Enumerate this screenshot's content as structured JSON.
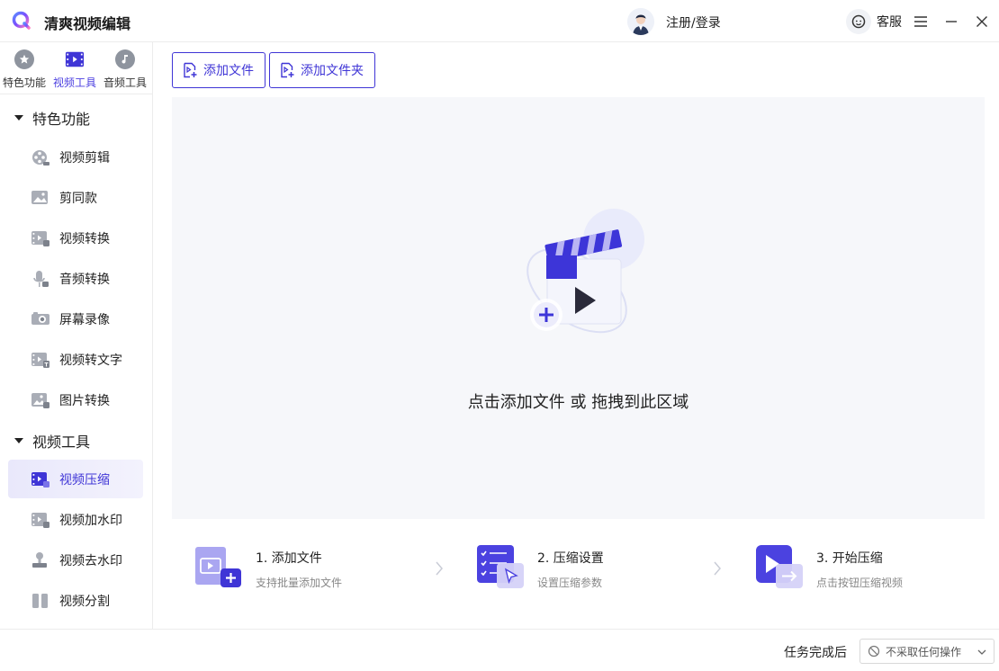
{
  "app": {
    "title": "清爽视频编辑"
  },
  "header": {
    "login_label": "注册/登录",
    "support_label": "客服"
  },
  "tool_tabs": [
    {
      "label": "特色功能",
      "icon": "star-icon"
    },
    {
      "label": "视频工具",
      "icon": "film-icon",
      "active": true
    },
    {
      "label": "音频工具",
      "icon": "music-note-icon"
    }
  ],
  "sidebar": {
    "sections": [
      {
        "title": "特色功能",
        "items": [
          {
            "label": "视频剪辑",
            "icon": "film-reel-icon"
          },
          {
            "label": "剪同款",
            "icon": "image-icon"
          },
          {
            "label": "视频转换",
            "icon": "video-convert-icon"
          },
          {
            "label": "音频转换",
            "icon": "microphone-icon"
          },
          {
            "label": "屏幕录像",
            "icon": "screen-record-icon"
          },
          {
            "label": "视频转文字",
            "icon": "video-text-icon"
          },
          {
            "label": "图片转换",
            "icon": "image-convert-icon"
          }
        ]
      },
      {
        "title": "视频工具",
        "items": [
          {
            "label": "视频压缩",
            "icon": "video-compress-icon",
            "active": true
          },
          {
            "label": "视频加水印",
            "icon": "watermark-add-icon"
          },
          {
            "label": "视频去水印",
            "icon": "watermark-remove-icon"
          },
          {
            "label": "视频分割",
            "icon": "split-icon"
          }
        ]
      }
    ]
  },
  "toolbar": {
    "add_file_label": "添加文件",
    "add_folder_label": "添加文件夹"
  },
  "dropzone": {
    "text": "点击添加文件 或 拖拽到此区域"
  },
  "steps": [
    {
      "title": "1. 添加文件",
      "desc": "支持批量添加文件",
      "icon": "add-file-icon"
    },
    {
      "title": "2. 压缩设置",
      "desc": "设置压缩参数",
      "icon": "settings-checklist-icon"
    },
    {
      "title": "3. 开始压缩",
      "desc": "点击按钮压缩视频",
      "icon": "start-compress-icon"
    }
  ],
  "bottom": {
    "after_label": "任务完成后",
    "after_value": "不采取任何操作"
  },
  "colors": {
    "accent": "#3f35d6",
    "dropzone_bg": "#f6f7fa",
    "active_item_bg": "#e9e8fb"
  }
}
